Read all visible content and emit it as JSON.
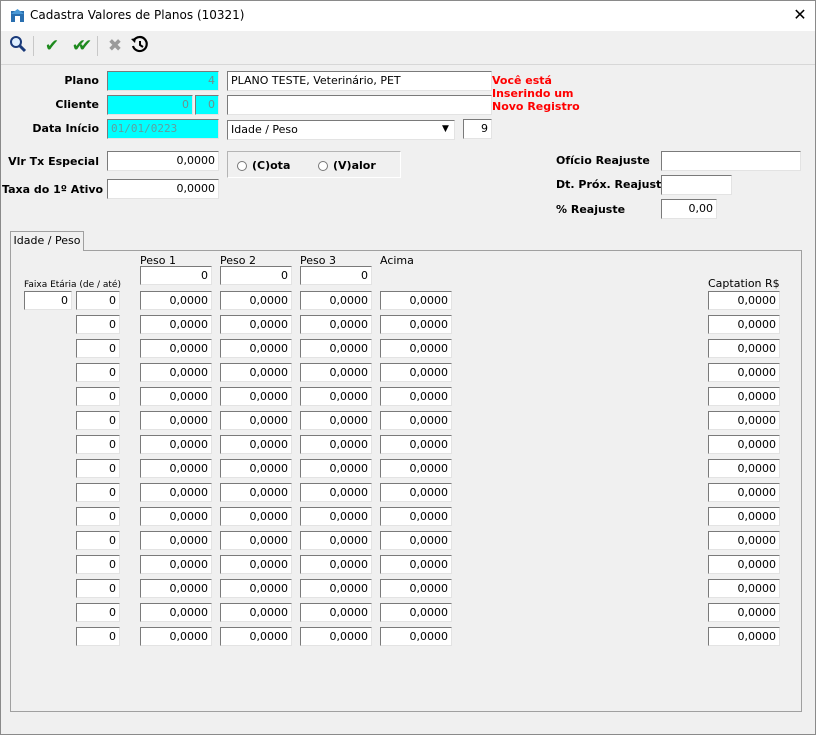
{
  "window": {
    "title": "Cadastra Valores de Planos (10321)"
  },
  "icons": [
    "app-icon",
    "search-icon",
    "check-icon",
    "double-check-icon",
    "cancel-icon",
    "history-icon",
    "close-icon"
  ],
  "form": {
    "plano": {
      "label": "Plano",
      "code": "4",
      "description": "PLANO TESTE, Veterinário, PET"
    },
    "cliente": {
      "label": "Cliente",
      "code1": "0",
      "code2": "0",
      "description": ""
    },
    "data_inicio": {
      "label": "Data Início",
      "value": "01/01/0223",
      "tabela": "Idade / Peso",
      "tabela_num": "9"
    },
    "warning": [
      "Você está",
      "Inserindo um",
      "Novo Registro"
    ],
    "vlr_tx_especial": {
      "label": "Vlr Tx Especial",
      "value": "0,0000"
    },
    "taxa_primeiro_ativo": {
      "label": "Taxa do 1º Ativo",
      "value": "0,0000"
    },
    "tipo": {
      "options": [
        "(C)ota",
        "(V)alor"
      ]
    },
    "oficio_reajuste": {
      "label": "Ofício Reajuste",
      "value": ""
    },
    "dt_prox_reajuste": {
      "label": "Dt. Próx. Reajuste",
      "value": ""
    },
    "pct_reajuste": {
      "label": "% Reajuste",
      "value": "0,00"
    }
  },
  "tab": {
    "label": "Idade / Peso"
  },
  "grid": {
    "faixa_label": "Faixa Etária (de / até)",
    "headers": [
      "Peso 1",
      "Peso 2",
      "Peso 3",
      "Acima"
    ],
    "header_values": [
      "0",
      "0",
      "0"
    ],
    "captation_label": "Captation R$",
    "rows": [
      {
        "de": "0",
        "ate": "0",
        "p1": "0,0000",
        "p2": "0,0000",
        "p3": "0,0000",
        "acima": "0,0000",
        "captation": "0,0000"
      },
      {
        "ate": "0",
        "p1": "0,0000",
        "p2": "0,0000",
        "p3": "0,0000",
        "acima": "0,0000",
        "captation": "0,0000"
      },
      {
        "ate": "0",
        "p1": "0,0000",
        "p2": "0,0000",
        "p3": "0,0000",
        "acima": "0,0000",
        "captation": "0,0000"
      },
      {
        "ate": "0",
        "p1": "0,0000",
        "p2": "0,0000",
        "p3": "0,0000",
        "acima": "0,0000",
        "captation": "0,0000"
      },
      {
        "ate": "0",
        "p1": "0,0000",
        "p2": "0,0000",
        "p3": "0,0000",
        "acima": "0,0000",
        "captation": "0,0000"
      },
      {
        "ate": "0",
        "p1": "0,0000",
        "p2": "0,0000",
        "p3": "0,0000",
        "acima": "0,0000",
        "captation": "0,0000"
      },
      {
        "ate": "0",
        "p1": "0,0000",
        "p2": "0,0000",
        "p3": "0,0000",
        "acima": "0,0000",
        "captation": "0,0000"
      },
      {
        "ate": "0",
        "p1": "0,0000",
        "p2": "0,0000",
        "p3": "0,0000",
        "acima": "0,0000",
        "captation": "0,0000"
      },
      {
        "ate": "0",
        "p1": "0,0000",
        "p2": "0,0000",
        "p3": "0,0000",
        "acima": "0,0000",
        "captation": "0,0000"
      },
      {
        "ate": "0",
        "p1": "0,0000",
        "p2": "0,0000",
        "p3": "0,0000",
        "acima": "0,0000",
        "captation": "0,0000"
      },
      {
        "ate": "0",
        "p1": "0,0000",
        "p2": "0,0000",
        "p3": "0,0000",
        "acima": "0,0000",
        "captation": "0,0000"
      },
      {
        "ate": "0",
        "p1": "0,0000",
        "p2": "0,0000",
        "p3": "0,0000",
        "acima": "0,0000",
        "captation": "0,0000"
      },
      {
        "ate": "0",
        "p1": "0,0000",
        "p2": "0,0000",
        "p3": "0,0000",
        "acima": "0,0000",
        "captation": "0,0000"
      },
      {
        "ate": "0",
        "p1": "0,0000",
        "p2": "0,0000",
        "p3": "0,0000",
        "acima": "0,0000",
        "captation": "0,0000"
      },
      {
        "ate": "0",
        "p1": "0,0000",
        "p2": "0,0000",
        "p3": "0,0000",
        "acima": "0,0000",
        "captation": "0,0000"
      }
    ]
  }
}
